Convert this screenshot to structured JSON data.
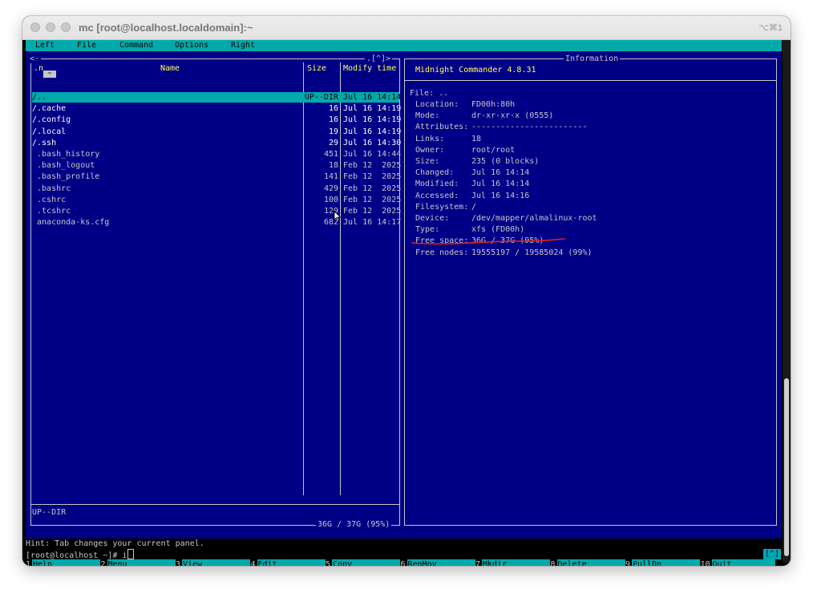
{
  "window": {
    "title": "mc [root@localhost.localdomain]:~",
    "shortcut": "⌥⌘1"
  },
  "menu": [
    "Left",
    "File",
    "Command",
    "Options",
    "Right"
  ],
  "left_panel": {
    "top_left": "<-",
    "path_chip": "~",
    "top_right": ".[^]>",
    "headers": {
      "name_sort": ".n",
      "name": "Name",
      "size": "Size",
      "mtime": "Modify time"
    },
    "files": [
      {
        "name": "/..",
        "size": "UP--DIR",
        "mtime": "Jul 16 14:14",
        "dir": true,
        "selected": true
      },
      {
        "name": "/.cache",
        "size": "16",
        "mtime": "Jul 16 14:19",
        "dir": true
      },
      {
        "name": "/.config",
        "size": "16",
        "mtime": "Jul 16 14:19",
        "dir": true
      },
      {
        "name": "/.local",
        "size": "19",
        "mtime": "Jul 16 14:19",
        "dir": true
      },
      {
        "name": "/.ssh",
        "size": "29",
        "mtime": "Jul 16 14:30",
        "dir": true
      },
      {
        "name": " .bash_history",
        "size": "451",
        "mtime": "Jul 16 14:44"
      },
      {
        "name": " .bash_logout",
        "size": "18",
        "mtime": "Feb 12  2025"
      },
      {
        "name": " .bash_profile",
        "size": "141",
        "mtime": "Feb 12  2025"
      },
      {
        "name": " .bashrc",
        "size": "429",
        "mtime": "Feb 12  2025"
      },
      {
        "name": " .cshrc",
        "size": "100",
        "mtime": "Feb 12  2025"
      },
      {
        "name": " .tcshrc",
        "size": "129",
        "mtime": "Feb 12  2025"
      },
      {
        "name": " anaconda-ks.cfg",
        "size": "682",
        "mtime": "Jul 16 14:17"
      }
    ],
    "mini_status": "UP--DIR",
    "free_space": "36G / 37G (95%)"
  },
  "info_panel": {
    "title": "Information",
    "version": "Midnight Commander 4.8.31",
    "file_label": "File: ..",
    "rows": [
      {
        "key": "Location:",
        "value": "FD00h:80h"
      },
      {
        "key": "Mode:",
        "value": "dr-xr-xr-x (0555)"
      },
      {
        "key": "Attributes:",
        "value": "------------------------"
      },
      {
        "key": "Links:",
        "value": "18"
      },
      {
        "key": "Owner:",
        "value": "root/root"
      },
      {
        "key": "Size:",
        "value": "235 (0 blocks)"
      },
      {
        "key": "Changed:",
        "value": "Jul 16 14:14"
      },
      {
        "key": "Modified:",
        "value": "Jul 16 14:14"
      },
      {
        "key": "Accessed:",
        "value": "Jul 16 14:16"
      },
      {
        "key": "Filesystem:",
        "value": "/"
      },
      {
        "key": "Device:",
        "value": "/dev/mapper/almalinux-root"
      },
      {
        "key": "Type:",
        "value": "xfs (FD00h)"
      },
      {
        "key": "Free space:",
        "value": "36G / 37G (95%)"
      },
      {
        "key": "Free nodes:",
        "value": "19555197 / 19585024 (99%)"
      }
    ]
  },
  "hint": "Hint: Tab changes your current panel.",
  "prompt": "[root@localhost ~]# i",
  "prompt_right": "[^]",
  "fkeys": [
    {
      "num": "1",
      "label": "Help"
    },
    {
      "num": "2",
      "label": "Menu"
    },
    {
      "num": "3",
      "label": "View"
    },
    {
      "num": "4",
      "label": "Edit"
    },
    {
      "num": "5",
      "label": "Copy"
    },
    {
      "num": "6",
      "label": "RenMov"
    },
    {
      "num": "7",
      "label": "Mkdir"
    },
    {
      "num": "8",
      "label": "Delete"
    },
    {
      "num": "9",
      "label": "PullDn"
    },
    {
      "num": "10",
      "label": "Quit"
    }
  ],
  "colors": {
    "panel_bg": "#000087",
    "accent": "#00aaaa",
    "highlight": "#ffff55",
    "annotation": "#e02020"
  }
}
